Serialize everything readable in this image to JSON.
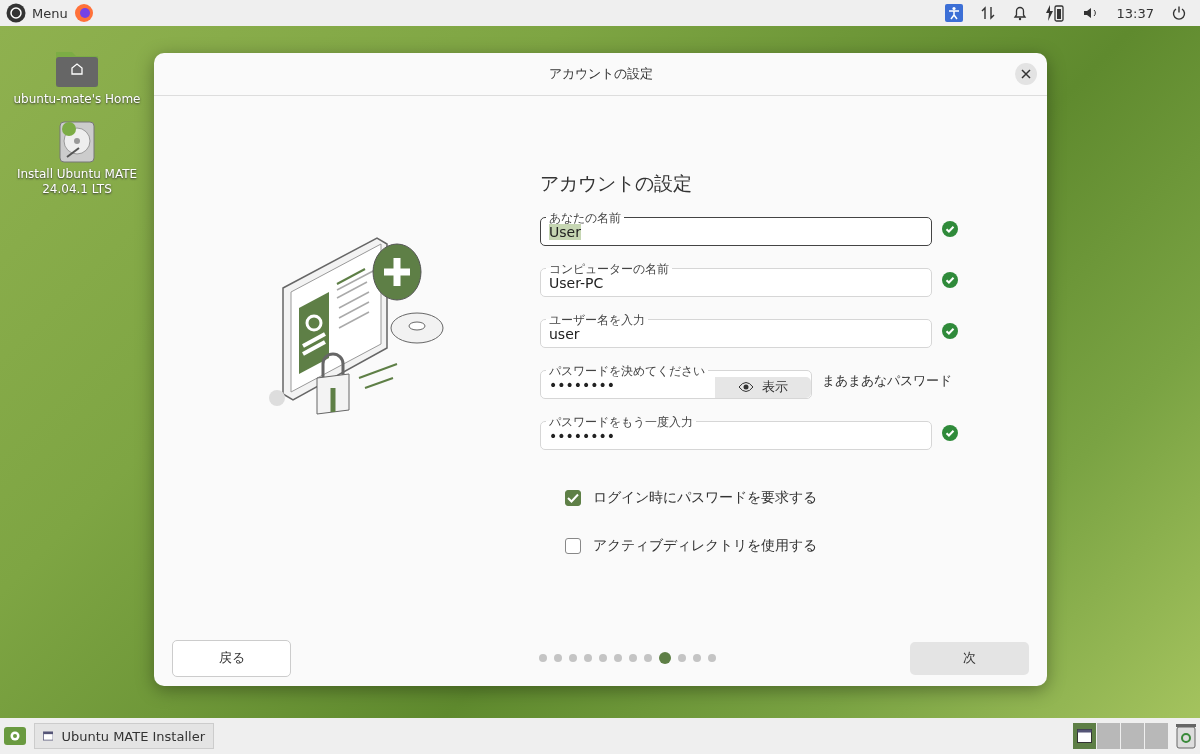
{
  "top_panel": {
    "menu_label": "Menu",
    "clock": "13:37"
  },
  "desktop_icons": [
    {
      "kind": "folder",
      "label": "ubuntu-mate's Home"
    },
    {
      "kind": "installer",
      "label": "Install Ubuntu MATE 24.04.1 LTS"
    }
  ],
  "dialog": {
    "title": "アカウントの設定",
    "heading": "アカウントの設定",
    "fields": [
      {
        "kind": "text",
        "label": "あなたの名前",
        "value": "User",
        "focused": true,
        "valid": true
      },
      {
        "kind": "text",
        "label": "コンピューターの名前",
        "value": "User-PC",
        "focused": false,
        "valid": true
      },
      {
        "kind": "text",
        "label": "ユーザー名を入力",
        "value": "user",
        "focused": false,
        "valid": true
      },
      {
        "kind": "password",
        "label": "パスワードを決めてください",
        "value": "••••••••",
        "focused": false,
        "show_button": "表示",
        "strength": "まあまあなパスワード"
      },
      {
        "kind": "text",
        "label": "パスワードをもう一度入力",
        "value": "••••••••",
        "focused": false,
        "valid": true
      }
    ],
    "checkboxes": [
      {
        "label": "ログイン時にパスワードを要求する",
        "checked": true
      },
      {
        "label": "アクティブディレクトリを使用する",
        "checked": false
      }
    ],
    "back_button": "戻る",
    "next_button": "次",
    "steps": [
      {
        "selected": false
      },
      {
        "selected": false
      },
      {
        "selected": false
      },
      {
        "selected": false
      },
      {
        "selected": false
      },
      {
        "selected": false
      },
      {
        "selected": false
      },
      {
        "selected": false
      },
      {
        "selected": true
      },
      {
        "selected": false
      },
      {
        "selected": false
      },
      {
        "selected": false
      }
    ]
  },
  "bottom_panel": {
    "task": "Ubuntu MATE Installer",
    "workspaces": [
      {
        "selected": true
      },
      {
        "selected": false
      },
      {
        "selected": false
      },
      {
        "selected": false
      }
    ]
  }
}
